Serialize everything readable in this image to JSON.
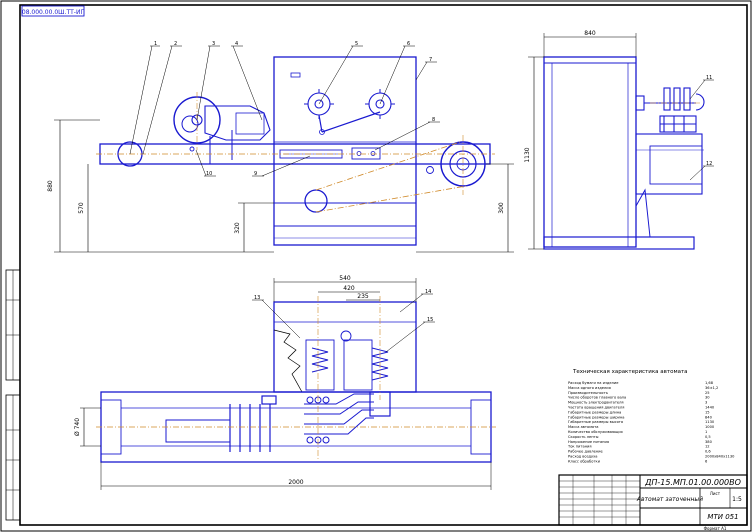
{
  "sheet": {
    "stamp_code": "08.000.00.0Ш.ТТ-ИГ",
    "doc_code": "ДП-15.МП.01.00.000ВО",
    "machine_name": "Автомат заточенный",
    "organization": "МТИ 051",
    "scale": "1:5",
    "sheet_no": "Лист",
    "format": "Формат А1"
  },
  "dimensions": {
    "front_height": "880",
    "front_inner_height": "570",
    "front_base_height": "320",
    "front_right_height": "300",
    "side_width": "840",
    "side_height": "1130",
    "top_overall": "540",
    "top_mid": "420",
    "top_inner": "235",
    "top_length": "2000",
    "top_width": "Ø 740"
  },
  "callouts": [
    "1",
    "2",
    "3",
    "4",
    "5",
    "6",
    "7",
    "8",
    "9",
    "10",
    "11",
    "12",
    "13",
    "14",
    "15",
    "16",
    "17",
    "18"
  ],
  "specs": {
    "title": "Техническая характеристика автомата",
    "rows": [
      {
        "label": "Расход бумаги на изделие",
        "value": "1,68"
      },
      {
        "label": "Масса одного изделия",
        "value": "36±1,2"
      },
      {
        "label": "Производительность",
        "value": "25"
      },
      {
        "label": "Число оборотов главного вала",
        "value": "30"
      },
      {
        "label": "Мощность электродвигателя",
        "value": "3"
      },
      {
        "label": "Частота вращения двигателя",
        "value": "1440"
      },
      {
        "label": "Габаритные размеры длина",
        "value": "15"
      },
      {
        "label": "Габаритные размеры ширина",
        "value": "840"
      },
      {
        "label": "Габаритные размеры высота",
        "value": "1130"
      },
      {
        "label": "Масса автомата",
        "value": "1000"
      },
      {
        "label": "Количество обслуживающих",
        "value": "1"
      },
      {
        "label": "Скорость ленты",
        "value": "0,5"
      },
      {
        "label": "Напряжение питания",
        "value": "380"
      },
      {
        "label": "Ток питания",
        "value": "12"
      },
      {
        "label": "Рабочее давление",
        "value": "0,6"
      },
      {
        "label": "Расход воздуха",
        "value": "2000х840х1130"
      },
      {
        "label": "Класс обработки",
        "value": "6"
      }
    ]
  }
}
